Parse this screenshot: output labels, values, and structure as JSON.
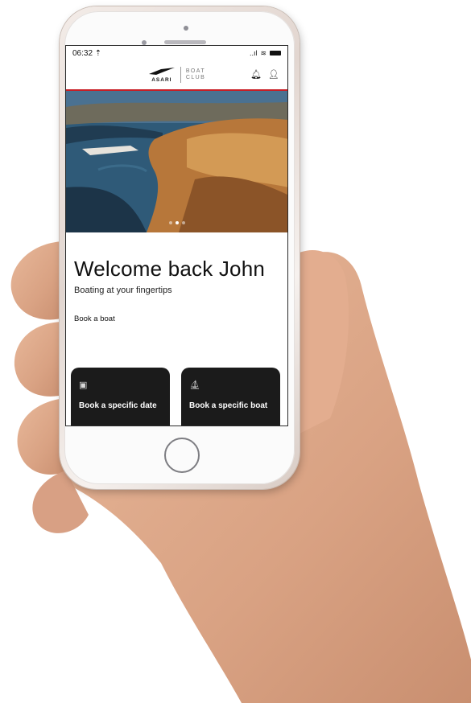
{
  "status_bar": {
    "time": "06:32 ⇡",
    "signal": "..ıl",
    "wifi": "≋"
  },
  "header": {
    "brand": "ASARI",
    "club_line1": "BOAT",
    "club_line2": "CLUB",
    "accent_color": "#c81e26"
  },
  "hero": {
    "dots": 3,
    "active_dot": 1
  },
  "welcome": {
    "title": "Welcome back John",
    "subtitle": "Boating at your fingertips"
  },
  "booking": {
    "section_label": "Book a boat",
    "cards": [
      {
        "icon": "calendar-icon",
        "label": "Book a specific date"
      },
      {
        "icon": "boat-icon",
        "label": "Book a specific boat"
      }
    ]
  }
}
